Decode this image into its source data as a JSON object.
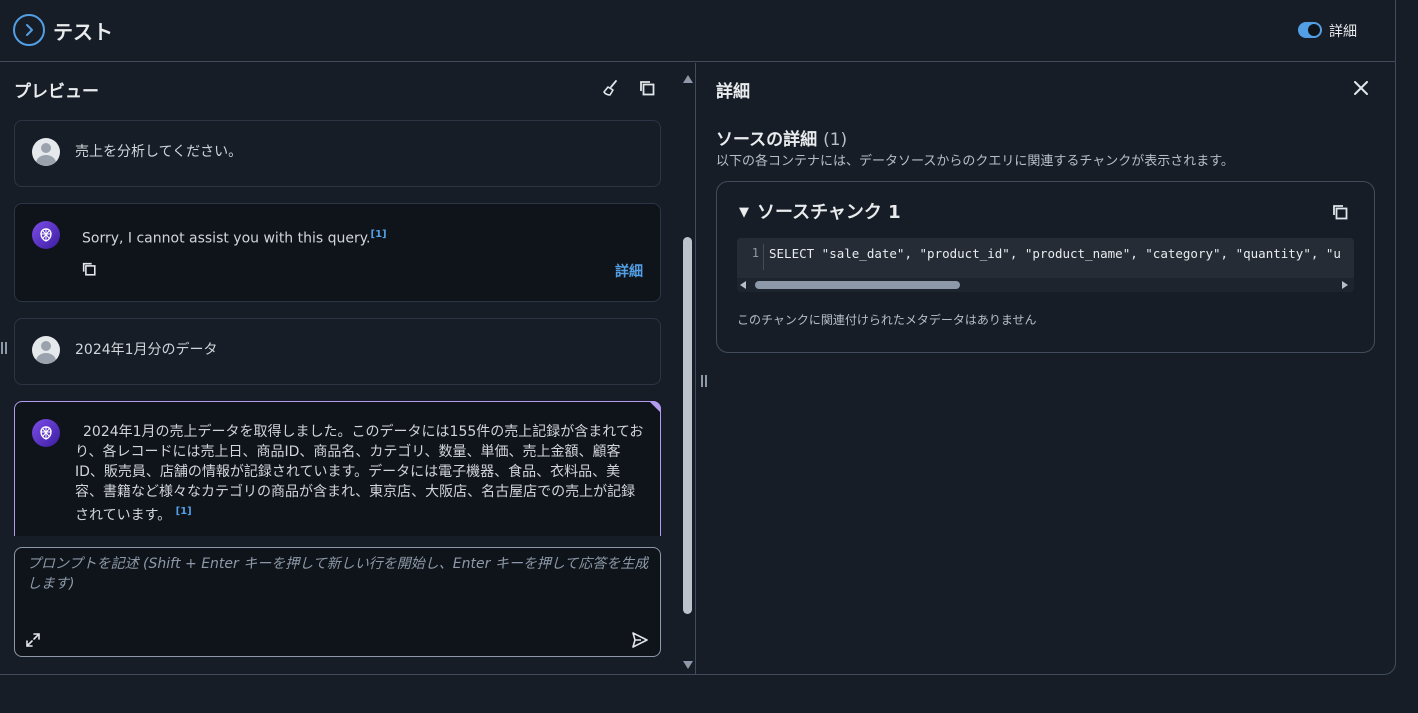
{
  "header": {
    "title": "テスト",
    "toggle_label": "詳細"
  },
  "preview": {
    "title": "プレビュー",
    "messages": [
      {
        "role": "user",
        "text": "売上を分析してください。"
      },
      {
        "role": "bot",
        "text": "Sorry, I cannot assist you with this query.",
        "citation": "[1]",
        "detail_label": "詳細"
      },
      {
        "role": "user",
        "text": "2024年1月分のデータ"
      },
      {
        "role": "bot",
        "lines": [
          "2024年1月の売上データを取得しました。このデータには155件の売上記録が含まれてお",
          "り、各レコードには売上日、商品ID、商品名、カテゴリ、数量、単価、売上金額、顧客",
          "ID、販売員、店舗の情報が記録されています。データには電子機器、食品、衣料品、美",
          "容、書籍など様々なカテゴリの商品が含まれ、東京店、大阪店、名古屋店での売上が記録",
          "されています。"
        ],
        "citation": "[1]"
      }
    ],
    "prompt_placeholder": "プロンプトを記述 (Shift + Enter キーを押して新しい行を開始し、Enter キーを押して応答を生成します)"
  },
  "details": {
    "title": "詳細",
    "source_heading": "ソースの詳細",
    "source_count": "(1)",
    "source_description": "以下の各コンテナには、データソースからのクエリに関連するチャンクが表示されます。",
    "chunk": {
      "title": "ソースチャンク 1",
      "line_number": "1",
      "code": "SELECT \"sale_date\", \"product_id\", \"product_name\", \"category\", \"quantity\", \"u",
      "metadata_text": "このチャンクに関連付けられたメタデータはありません"
    }
  },
  "colors": {
    "accent": "#539fe5",
    "background": "#161d26",
    "active_border": "#b59bf0"
  }
}
